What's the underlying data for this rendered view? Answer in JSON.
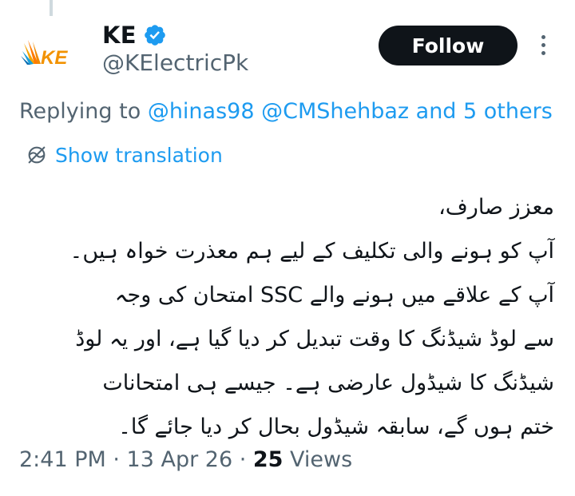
{
  "colors": {
    "accent": "#1d9bf0",
    "text_primary": "#0f1419",
    "text_secondary": "#536471",
    "follow_bg": "#0f1419"
  },
  "author": {
    "avatar_text": "KE",
    "display_name": "KE",
    "handle": "@KElectricPk",
    "verified_icon": "verified-badge-icon"
  },
  "actions": {
    "follow_label": "Follow",
    "more_icon": "more-options-icon"
  },
  "reply_context": {
    "prefix": "Replying to",
    "mentions": "@hinas98 @CMShehbaz and 5 others"
  },
  "translation": {
    "icon": "translate-icon",
    "label": "Show translation"
  },
  "tweet": {
    "lines": [
      "معزز صارف،",
      "آپ کو ہونے والی تکلیف کے لیے ہم معذرت خواہ ہیں۔",
      "آپ کے علاقے میں ہونے والے SSC امتحان کی وجہ",
      "سے لوڈ شیڈنگ کا وقت تبدیل کر دیا گیا ہے، اور یہ لوڈ",
      "شیڈنگ کا شیڈول عارضی ہے۔ جیسے ہی امتحانات",
      "ختم ہوں گے، سابقہ شیڈول بحال کر دیا جائے گا۔"
    ]
  },
  "meta": {
    "time": "2:41 PM",
    "separator": " · ",
    "date": "13 Apr 26",
    "views_count": "25",
    "views_label": " Views"
  }
}
